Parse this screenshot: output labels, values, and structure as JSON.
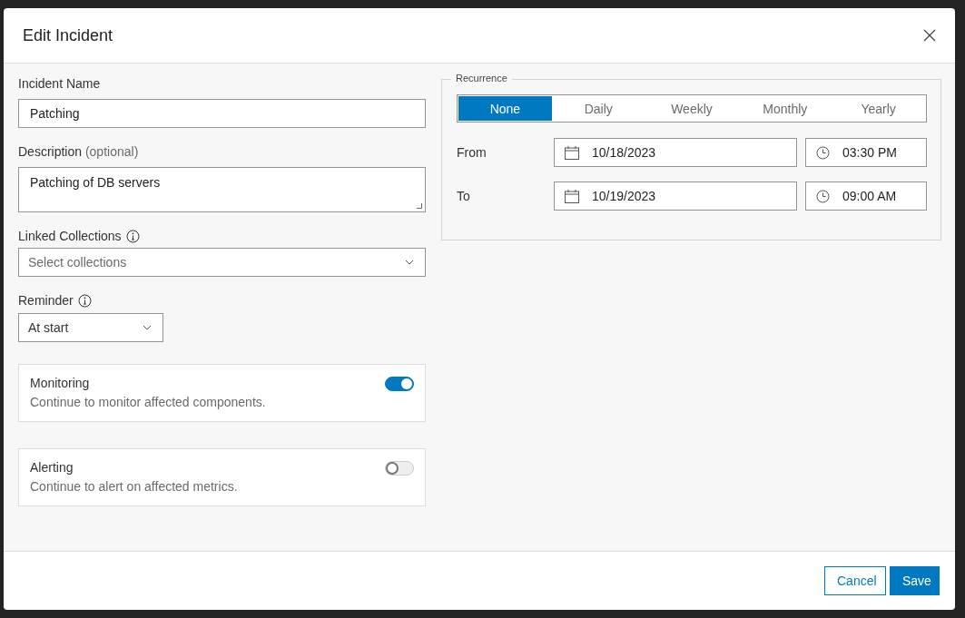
{
  "dialog": {
    "title": "Edit Incident"
  },
  "fields": {
    "name": {
      "label": "Incident Name",
      "value": "Patching"
    },
    "description": {
      "label": "Description",
      "label_hint": "(optional)",
      "value": "Patching of DB servers"
    },
    "collections": {
      "label": "Linked Collections",
      "placeholder": "Select collections"
    },
    "reminder": {
      "label": "Reminder",
      "value": "At start"
    }
  },
  "options": [
    {
      "title": "Monitoring",
      "description": "Continue to monitor affected components.",
      "on": true
    },
    {
      "title": "Alerting",
      "description": "Continue to alert on affected metrics.",
      "on": false
    }
  ],
  "recurrence": {
    "legend": "Recurrence",
    "segments": [
      {
        "label": "None",
        "selected": true
      },
      {
        "label": "Daily",
        "selected": false
      },
      {
        "label": "Weekly",
        "selected": false
      },
      {
        "label": "Monthly",
        "selected": false
      },
      {
        "label": "Yearly",
        "selected": false
      }
    ],
    "rows": [
      {
        "label": "From",
        "date": "10/18/2023",
        "time": "03:30 PM"
      },
      {
        "label": "To",
        "date": "10/19/2023",
        "time": "09:00 AM"
      }
    ]
  },
  "buttons": {
    "cancel": "Cancel",
    "save": "Save"
  }
}
